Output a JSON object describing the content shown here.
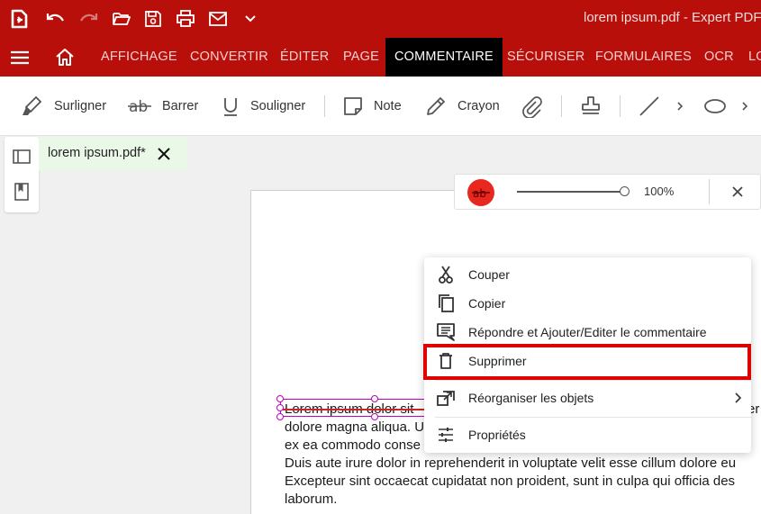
{
  "window": {
    "title": "lorem ipsum.pdf   -   Expert PDF"
  },
  "quick_access": [
    "app-logo-icon",
    "undo-icon",
    "redo-icon",
    "open-folder-icon",
    "save-icon",
    "print-icon",
    "mail-icon",
    "chevron-down-icon"
  ],
  "menu": {
    "items": [
      "AFFICHAGE",
      "CONVERTIR",
      "ÉDITER",
      "PAGE",
      "COMMENTAIRE",
      "SÉCURISER",
      "FORMULAIRES",
      "OCR",
      "LO"
    ],
    "active": "COMMENTAIRE"
  },
  "toolbar": {
    "highlight": "Surligner",
    "strikeout": "Barrer",
    "underline": "Souligner",
    "note": "Note",
    "pencil": "Crayon"
  },
  "tab": {
    "name": "lorem ipsum.pdf*"
  },
  "properties": {
    "color": "#e8271f",
    "opacity_label": "100%",
    "opacity_value": 1.0
  },
  "document": {
    "lines": [
      "Lorem ipsum dolor sit",
      "dolore magna aliqua. U",
      "ex ea commodo conse",
      "Duis aute irure dolor in reprehenderit in voluptate velit esse cillum dolore eu",
      "Excepteur sint occaecat cupidatat non proident, sunt in culpa qui officia des",
      "laborum."
    ],
    "line1_tail": "er"
  },
  "context_menu": {
    "items": [
      {
        "label": "Couper",
        "icon": "scissors-icon"
      },
      {
        "label": "Copier",
        "icon": "copy-icon"
      },
      {
        "label": "Répondre et Ajouter/Editer le commentaire",
        "icon": "comment-icon"
      },
      {
        "label": "Supprimer",
        "icon": "trash-icon"
      },
      {
        "label": "Réorganiser les objets",
        "icon": "arrange-icon"
      },
      {
        "label": "Propriétés",
        "icon": "properties-icon"
      }
    ],
    "highlighted": "Supprimer"
  },
  "colors": {
    "brand": "#b80f0a",
    "active_tab": "#000000",
    "highlight": "#e00000",
    "annotation": "#c000c0"
  }
}
